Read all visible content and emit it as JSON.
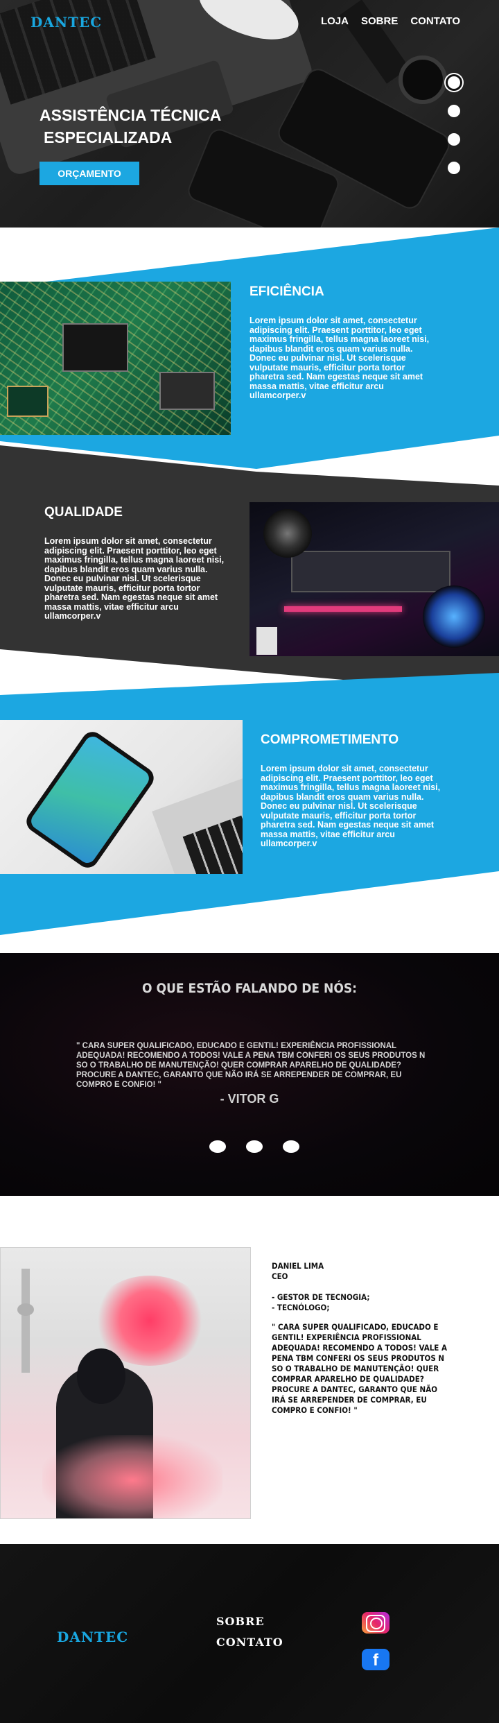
{
  "header": {
    "logo": "DANTEC",
    "nav": [
      "LOJA",
      "SOBRE",
      "CONTATO"
    ]
  },
  "hero": {
    "title_line1": "ASSISTÊNCIA TÉCNICA",
    "title_line2": "ESPECIALIZADA",
    "button": "ORÇAMENTO",
    "slider_dots": 4,
    "active_dot": 1
  },
  "sections": [
    {
      "title": "EFICIÊNCIA",
      "text": "Lorem ipsum dolor sit amet, consectetur adipiscing elit. Praesent porttitor, leo eget maximus fringilla, tellus magna laoreet nisi, dapibus blandit eros quam varius nulla. Donec eu pulvinar nisl. Ut scelerisque vulputate mauris, efficitur porta tortor pharetra sed. Nam egestas neque sit amet massa mattis, vitae efficitur arcu ullamcorper.v"
    },
    {
      "title": "QUALIDADE",
      "text": "Lorem ipsum dolor sit amet, consectetur adipiscing elit. Praesent porttitor, leo eget maximus fringilla, tellus magna laoreet nisi, dapibus blandit eros quam varius nulla. Donec eu pulvinar nisl. Ut scelerisque vulputate mauris, efficitur porta tortor pharetra sed. Nam egestas neque sit amet massa mattis, vitae efficitur arcu ullamcorper.v"
    },
    {
      "title": "COMPROMETIMENTO",
      "text": "Lorem ipsum dolor sit amet, consectetur adipiscing elit. Praesent porttitor, leo eget maximus fringilla, tellus magna laoreet nisi, dapibus blandit eros quam varius nulla. Donec eu pulvinar nisl. Ut scelerisque vulputate mauris, efficitur porta tortor pharetra sed. Nam egestas neque sit amet massa mattis, vitae efficitur arcu ullamcorper.v"
    }
  ],
  "testimonial": {
    "title": "O QUE ESTÃO FALANDO DE NÓS:",
    "quote": "\" CARA SUPER QUALIFICADO, EDUCADO E GENTIL! EXPERIÊNCIA PROFISSIONAL ADEQUADA! RECOMENDO A TODOS! VALE A PENA TBM CONFERI OS SEUS PRODUTOS N SO O TRABALHO DE MANUTENÇÃO! QUER COMPRAR APARELHO DE QUALIDADE? PROCURE A DANTEC, GARANTO QUE NÃO IRÁ SE ARREPENDER DE COMPRAR, EU COMPRO E CONFIO! \"",
    "author": "- VITOR G",
    "dots": 3
  },
  "profile": {
    "name": "DANIEL LIMA",
    "role": "CEO",
    "items": [
      "- GESTOR DE TECNOGIA;",
      "- TECNÓLOGO;"
    ],
    "quote": "\" CARA SUPER QUALIFICADO, EDUCADO E GENTIL! EXPERIÊNCIA PROFISSIONAL ADEQUADA! RECOMENDO A TODOS! VALE A PENA TBM CONFERI OS SEUS PRODUTOS N SO O TRABALHO DE MANUTENÇÃO! QUER COMPRAR APARELHO DE QUALIDADE? PROCURE A DANTEC, GARANTO QUE NÃO IRÁ SE ARREPENDER DE COMPRAR, EU COMPRO E CONFIO! \""
  },
  "footer": {
    "logo": "DANTEC",
    "links": [
      "SOBRE",
      "CONTATO"
    ],
    "social": [
      "instagram-icon",
      "facebook-icon"
    ],
    "facebook_glyph": "f"
  },
  "colors": {
    "accent": "#1ca7e1",
    "dark_band": "#333333",
    "logo": "#19a6df"
  }
}
